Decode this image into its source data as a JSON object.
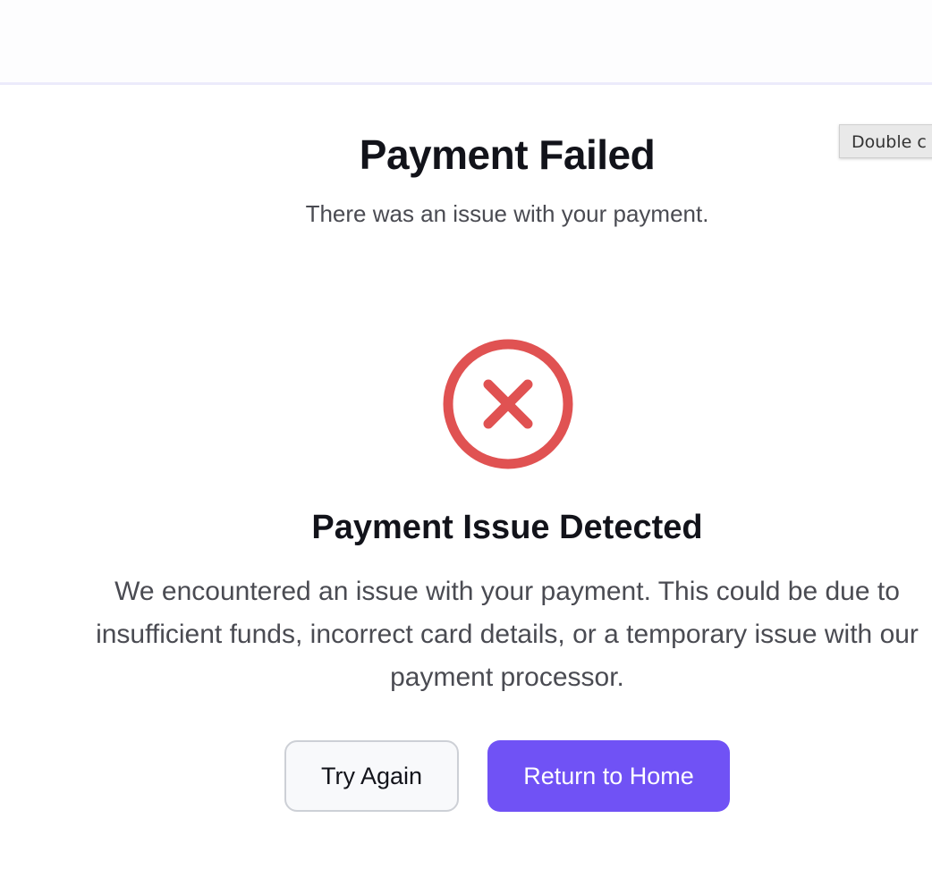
{
  "tooltip": {
    "text": "Double c"
  },
  "header": {
    "title": "Payment Failed",
    "subtitle": "There was an issue with your payment."
  },
  "status": {
    "icon": "error-x-circle-icon",
    "color": "#e05252",
    "heading": "Payment Issue Detected",
    "message": "We encountered an issue with your payment. This could be due to insufficient funds, incorrect card details, or a temporary issue with our payment processor."
  },
  "actions": {
    "try_again_label": "Try Again",
    "return_home_label": "Return to Home",
    "primary_color": "#7052f5"
  }
}
